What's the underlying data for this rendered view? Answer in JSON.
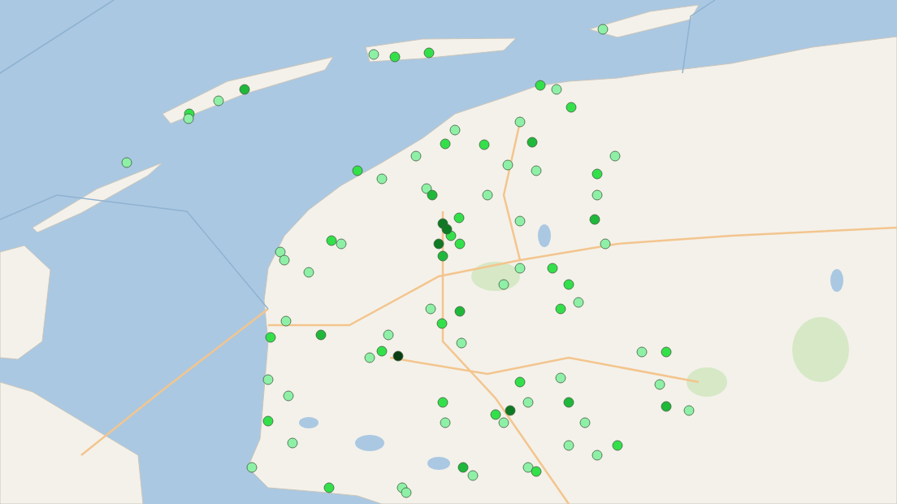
{
  "map": {
    "markers": [
      {
        "color": "#8ef0a6"
      },
      {
        "color": "#33e04a"
      },
      {
        "color": "#8ef0a6"
      },
      {
        "color": "#33e04a"
      },
      {
        "color": "#1fb83a"
      },
      {
        "color": "#8ef0a6"
      },
      {
        "color": "#33e04a"
      },
      {
        "color": "#8ef0a6"
      },
      {
        "color": "#8ef0a6"
      },
      {
        "color": "#33e04a"
      },
      {
        "color": "#8ef0a6"
      },
      {
        "color": "#33e04a"
      },
      {
        "color": "#8ef0a6"
      },
      {
        "color": "#1fb83a"
      },
      {
        "color": "#8ef0a6"
      },
      {
        "color": "#33e04a"
      },
      {
        "color": "#8ef0a6"
      },
      {
        "color": "#8ef0a6"
      },
      {
        "color": "#33e04a"
      },
      {
        "color": "#8ef0a6"
      },
      {
        "color": "#1fb83a"
      },
      {
        "color": "#0e7a24"
      },
      {
        "color": "#33e04a"
      },
      {
        "color": "#0e7a24"
      },
      {
        "color": "#1fb83a"
      },
      {
        "color": "#33e04a"
      },
      {
        "color": "#0e7a24"
      },
      {
        "color": "#33e04a"
      },
      {
        "color": "#8ef0a6"
      },
      {
        "color": "#8ef0a6"
      },
      {
        "color": "#33e04a"
      },
      {
        "color": "#8ef0a6"
      },
      {
        "color": "#8ef0a6"
      },
      {
        "color": "#33e04a"
      },
      {
        "color": "#8ef0a6"
      },
      {
        "color": "#8ef0a6"
      },
      {
        "color": "#1fb83a"
      },
      {
        "color": "#8ef0a6"
      },
      {
        "color": "#33e04a"
      },
      {
        "color": "#8ef0a6"
      },
      {
        "color": "#33e04a"
      },
      {
        "color": "#8ef0a6"
      },
      {
        "color": "#8ef0a6"
      },
      {
        "color": "#33e04a"
      },
      {
        "color": "#0b3d14"
      },
      {
        "color": "#33e04a"
      },
      {
        "color": "#8ef0a6"
      },
      {
        "color": "#8ef0a6"
      },
      {
        "color": "#1fb83a"
      },
      {
        "color": "#8ef0a6"
      },
      {
        "color": "#33e04a"
      },
      {
        "color": "#8ef0a6"
      },
      {
        "color": "#0e7a24"
      },
      {
        "color": "#33e04a"
      },
      {
        "color": "#8ef0a6"
      },
      {
        "color": "#8ef0a6"
      },
      {
        "color": "#33e04a"
      },
      {
        "color": "#8ef0a6"
      },
      {
        "color": "#1fb83a"
      },
      {
        "color": "#8ef0a6"
      },
      {
        "color": "#8ef0a6"
      },
      {
        "color": "#33e04a"
      },
      {
        "color": "#8ef0a6"
      },
      {
        "color": "#8ef0a6"
      },
      {
        "color": "#33e04a"
      },
      {
        "color": "#8ef0a6"
      },
      {
        "color": "#1fb83a"
      },
      {
        "color": "#8ef0a6"
      },
      {
        "color": "#8ef0a6"
      },
      {
        "color": "#33e04a"
      },
      {
        "color": "#8ef0a6"
      },
      {
        "color": "#8ef0a6"
      },
      {
        "color": "#33e04a"
      },
      {
        "color": "#8ef0a6"
      },
      {
        "color": "#8ef0a6"
      },
      {
        "color": "#1fb83a"
      },
      {
        "color": "#8ef0a6"
      },
      {
        "color": "#33e04a"
      },
      {
        "color": "#8ef0a6"
      },
      {
        "color": "#8ef0a6"
      },
      {
        "color": "#33e04a"
      },
      {
        "color": "#8ef0a6"
      },
      {
        "color": "#8ef0a6"
      },
      {
        "color": "#33e04a"
      },
      {
        "color": "#8ef0a6"
      },
      {
        "color": "#8ef0a6"
      },
      {
        "color": "#33e04a"
      },
      {
        "color": "#8ef0a6"
      },
      {
        "color": "#1fb83a"
      },
      {
        "color": "#8ef0a6"
      }
    ]
  }
}
